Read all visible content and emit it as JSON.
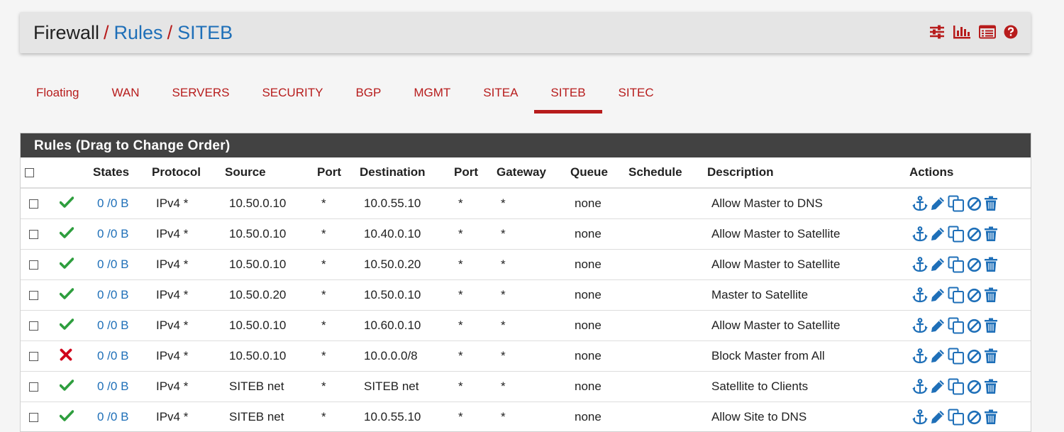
{
  "breadcrumb": {
    "home": "Firewall",
    "sep1": "/",
    "rules": "Rules",
    "sep2": "/",
    "current": "SITEB"
  },
  "header_icons": [
    "sliders-icon",
    "bar-chart-icon",
    "list-alt-icon",
    "help-icon"
  ],
  "tabs": [
    {
      "label": "Floating",
      "active": false
    },
    {
      "label": "WAN",
      "active": false
    },
    {
      "label": "SERVERS",
      "active": false
    },
    {
      "label": "SECURITY",
      "active": false
    },
    {
      "label": "BGP",
      "active": false
    },
    {
      "label": "MGMT",
      "active": false
    },
    {
      "label": "SITEA",
      "active": false
    },
    {
      "label": "SITEB",
      "active": true
    },
    {
      "label": "SITEC",
      "active": false
    }
  ],
  "panel": {
    "title": "Rules (Drag to Change Order)"
  },
  "columns": [
    "",
    "",
    "States",
    "Protocol",
    "Source",
    "Port",
    "Destination",
    "Port",
    "Gateway",
    "Queue",
    "Schedule",
    "Description",
    "Actions"
  ],
  "rows": [
    {
      "status": "pass",
      "states": "0 /0 B",
      "protocol": "IPv4 *",
      "source": "10.50.0.10",
      "sport": "*",
      "destination": "10.0.55.10",
      "dport": "*",
      "gateway": "*",
      "queue": "none",
      "schedule": "",
      "description": "Allow Master to DNS"
    },
    {
      "status": "pass",
      "states": "0 /0 B",
      "protocol": "IPv4 *",
      "source": "10.50.0.10",
      "sport": "*",
      "destination": "10.40.0.10",
      "dport": "*",
      "gateway": "*",
      "queue": "none",
      "schedule": "",
      "description": "Allow Master to Satellite"
    },
    {
      "status": "pass",
      "states": "0 /0 B",
      "protocol": "IPv4 *",
      "source": "10.50.0.10",
      "sport": "*",
      "destination": "10.50.0.20",
      "dport": "*",
      "gateway": "*",
      "queue": "none",
      "schedule": "",
      "description": "Allow Master to Satellite"
    },
    {
      "status": "pass",
      "states": "0 /0 B",
      "protocol": "IPv4 *",
      "source": "10.50.0.20",
      "sport": "*",
      "destination": "10.50.0.10",
      "dport": "*",
      "gateway": "*",
      "queue": "none",
      "schedule": "",
      "description": "Master to Satellite"
    },
    {
      "status": "pass",
      "states": "0 /0 B",
      "protocol": "IPv4 *",
      "source": "10.50.0.10",
      "sport": "*",
      "destination": "10.60.0.10",
      "dport": "*",
      "gateway": "*",
      "queue": "none",
      "schedule": "",
      "description": "Allow Master to Satellite"
    },
    {
      "status": "block",
      "states": "0 /0 B",
      "protocol": "IPv4 *",
      "source": "10.50.0.10",
      "sport": "*",
      "destination": "10.0.0.0/8",
      "dport": "*",
      "gateway": "*",
      "queue": "none",
      "schedule": "",
      "description": "Block Master from All"
    },
    {
      "status": "pass",
      "states": "0 /0 B",
      "protocol": "IPv4 *",
      "source": "SITEB net",
      "sport": "*",
      "destination": "SITEB net",
      "dport": "*",
      "gateway": "*",
      "queue": "none",
      "schedule": "",
      "description": "Satellite to Clients"
    },
    {
      "status": "pass",
      "states": "0 /0 B",
      "protocol": "IPv4 *",
      "source": "SITEB net",
      "sport": "*",
      "destination": "10.0.55.10",
      "dport": "*",
      "gateway": "*",
      "queue": "none",
      "schedule": "",
      "description": "Allow Site to DNS"
    }
  ],
  "row_action_icons": [
    "anchor-icon",
    "pencil-icon",
    "copy-icon",
    "disable-icon",
    "trash-icon"
  ],
  "colors": {
    "accent_red": "#b71c1c",
    "link_blue": "#1e6fb8",
    "pass_green": "#2e9e3e",
    "block_red": "#d0021b",
    "panel_head": "#424242"
  }
}
